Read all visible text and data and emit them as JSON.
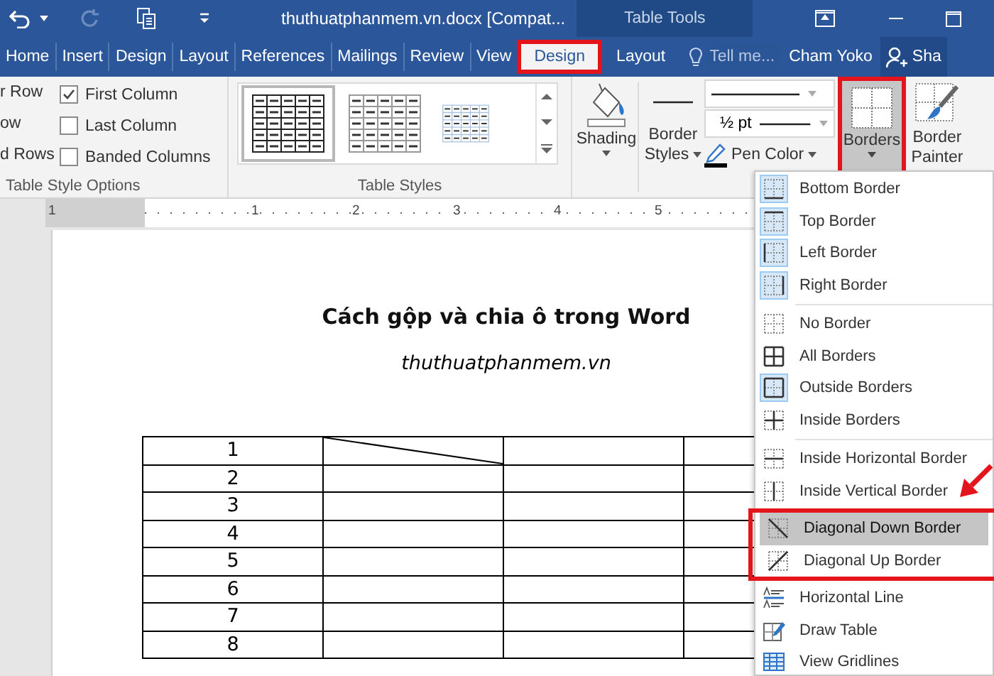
{
  "title_bar": {
    "title": "thuthuatphanmem.vn.docx [Compat...",
    "context_header": "Table Tools",
    "redo_disabled": true
  },
  "tabs": [
    {
      "label": "Home",
      "selected": false,
      "contextual": false,
      "highlighted": false
    },
    {
      "label": "Insert",
      "selected": false,
      "contextual": false,
      "highlighted": false
    },
    {
      "label": "Design",
      "selected": false,
      "contextual": false,
      "highlighted": false
    },
    {
      "label": "Layout",
      "selected": false,
      "contextual": false,
      "highlighted": false
    },
    {
      "label": "References",
      "selected": false,
      "contextual": false,
      "highlighted": false
    },
    {
      "label": "Mailings",
      "selected": false,
      "contextual": false,
      "highlighted": false
    },
    {
      "label": "Review",
      "selected": false,
      "contextual": false,
      "highlighted": false
    },
    {
      "label": "View",
      "selected": false,
      "contextual": false,
      "highlighted": false
    },
    {
      "label": "Design",
      "selected": true,
      "contextual": true,
      "highlighted": true
    },
    {
      "label": "Layout",
      "selected": false,
      "contextual": true,
      "highlighted": false
    }
  ],
  "tell_me": {
    "placeholder": "Tell me..."
  },
  "user": "Cham Yoko",
  "share": "Sha",
  "style_options": {
    "label": "Table Style Options",
    "cut_labels": [
      "r Row",
      "ow",
      "d Rows"
    ],
    "checkboxes": [
      {
        "label": "First Column",
        "checked": true
      },
      {
        "label": "Last Column",
        "checked": false
      },
      {
        "label": "Banded Columns",
        "checked": false
      }
    ]
  },
  "table_styles": {
    "label": "Table Styles",
    "styles": [
      {
        "kind": "grid",
        "selected": true
      },
      {
        "kind": "plain",
        "selected": false
      },
      {
        "kind": "light",
        "selected": false
      }
    ]
  },
  "shading": {
    "label": "Shading"
  },
  "borders_group": {
    "border_styles": [
      "Border",
      "Styles"
    ],
    "line_weight": "½ pt",
    "pen_color": "Pen Color",
    "borders_button": {
      "label": "Borders",
      "pressed": true,
      "highlighted": true
    },
    "painter": [
      "Border",
      "Painter"
    ]
  },
  "ruler": {
    "numbers": [
      "1",
      "1",
      "2",
      "3",
      "4",
      "5"
    ]
  },
  "document": {
    "title": "Cách gộp và chia ô trong Word",
    "subtitle": "thuthuatphanmem.vn",
    "rows": [
      {
        "number": "1",
        "diagonal_down": true
      },
      {
        "number": "2",
        "diagonal_down": false
      },
      {
        "number": "3",
        "diagonal_down": false
      },
      {
        "number": "4",
        "diagonal_down": false
      },
      {
        "number": "5",
        "diagonal_down": false
      },
      {
        "number": "6",
        "diagonal_down": false
      },
      {
        "number": "7",
        "diagonal_down": false
      },
      {
        "number": "8",
        "diagonal_down": false
      }
    ]
  },
  "menu": {
    "groups": [
      {
        "highlighted": false,
        "items": [
          {
            "kind": "bottom",
            "label": "Bottom Border",
            "checked": true,
            "selected": false
          },
          {
            "kind": "top",
            "label": "Top Border",
            "checked": true,
            "selected": false
          },
          {
            "kind": "left",
            "label": "Left Border",
            "checked": true,
            "selected": false
          },
          {
            "kind": "right",
            "label": "Right Border",
            "checked": true,
            "selected": false
          }
        ]
      },
      {
        "highlighted": false,
        "items": [
          {
            "kind": "none",
            "label": "No Border",
            "checked": false,
            "selected": false
          },
          {
            "kind": "all",
            "label": "All Borders",
            "checked": false,
            "selected": false
          },
          {
            "kind": "outside",
            "label": "Outside Borders",
            "checked": true,
            "selected": false
          },
          {
            "kind": "inside",
            "label": "Inside Borders",
            "checked": false,
            "selected": false
          }
        ]
      },
      {
        "highlighted": false,
        "items": [
          {
            "kind": "inside-h",
            "label": "Inside Horizontal Border",
            "checked": false,
            "selected": false
          },
          {
            "kind": "inside-v",
            "label": "Inside Vertical Border",
            "checked": false,
            "selected": false
          }
        ]
      },
      {
        "highlighted": true,
        "items": [
          {
            "kind": "diag-down",
            "label": "Diagonal Down Border",
            "checked": false,
            "selected": true
          },
          {
            "kind": "diag-up",
            "label": "Diagonal Up Border",
            "checked": false,
            "selected": false
          }
        ]
      },
      {
        "highlighted": false,
        "items": [
          {
            "kind": "hline",
            "label": "Horizontal Line",
            "checked": false,
            "selected": false
          },
          {
            "kind": "draw",
            "label": "Draw Table",
            "checked": false,
            "selected": false
          },
          {
            "kind": "gridlines",
            "label": "View Gridlines",
            "checked": false,
            "selected": false
          }
        ]
      }
    ]
  }
}
